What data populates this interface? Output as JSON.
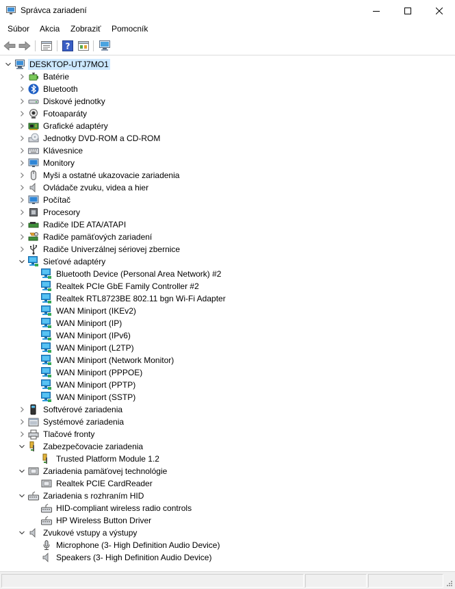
{
  "window": {
    "title": "Správca zariadení"
  },
  "menu": [
    "Súbor",
    "Akcia",
    "Zobraziť",
    "Pomocník"
  ],
  "toolbar": [
    {
      "name": "back-button",
      "icon": "back-arrow-icon"
    },
    {
      "name": "forward-button",
      "icon": "forward-arrow-icon"
    },
    {
      "name": "properties-button",
      "icon": "properties-icon"
    },
    {
      "name": "help-button",
      "icon": "help-icon"
    },
    {
      "name": "view-button",
      "icon": "view-icon"
    },
    {
      "name": "scan-hardware-button",
      "icon": "monitor-scan-icon"
    }
  ],
  "tree": [
    {
      "label": "DESKTOP-UTJ7MO1",
      "level": 0,
      "expander": "open",
      "icon": "computer",
      "selected": true
    },
    {
      "label": "Batérie",
      "level": 1,
      "expander": "closed",
      "icon": "battery"
    },
    {
      "label": "Bluetooth",
      "level": 1,
      "expander": "closed",
      "icon": "bluetooth"
    },
    {
      "label": "Diskové jednotky",
      "level": 1,
      "expander": "closed",
      "icon": "disk"
    },
    {
      "label": "Fotoaparáty",
      "level": 1,
      "expander": "closed",
      "icon": "camera"
    },
    {
      "label": "Grafické adaptéry",
      "level": 1,
      "expander": "closed",
      "icon": "display-adapter"
    },
    {
      "label": "Jednotky DVD-ROM a CD-ROM",
      "level": 1,
      "expander": "closed",
      "icon": "dvd"
    },
    {
      "label": "Klávesnice",
      "level": 1,
      "expander": "closed",
      "icon": "keyboard"
    },
    {
      "label": "Monitory",
      "level": 1,
      "expander": "closed",
      "icon": "monitor"
    },
    {
      "label": "Myši a ostatné ukazovacie zariadenia",
      "level": 1,
      "expander": "closed",
      "icon": "mouse"
    },
    {
      "label": "Ovládače zvuku, videa a hier",
      "level": 1,
      "expander": "closed",
      "icon": "speaker"
    },
    {
      "label": "Počítač",
      "level": 1,
      "expander": "closed",
      "icon": "monitor"
    },
    {
      "label": "Procesory",
      "level": 1,
      "expander": "closed",
      "icon": "processor"
    },
    {
      "label": "Radiče IDE ATA/ATAPI",
      "level": 1,
      "expander": "closed",
      "icon": "ide"
    },
    {
      "label": "Radiče pamäťových zariadení",
      "level": 1,
      "expander": "closed",
      "icon": "storage-controller"
    },
    {
      "label": "Radiče Univerzálnej sériovej zbernice",
      "level": 1,
      "expander": "closed",
      "icon": "usb"
    },
    {
      "label": "Sieťové adaptéry",
      "level": 1,
      "expander": "open",
      "icon": "network"
    },
    {
      "label": "Bluetooth Device (Personal Area Network) #2",
      "level": 2,
      "expander": "none",
      "icon": "network"
    },
    {
      "label": "Realtek PCIe GbE Family Controller #2",
      "level": 2,
      "expander": "none",
      "icon": "network"
    },
    {
      "label": "Realtek RTL8723BE 802.11 bgn Wi-Fi Adapter",
      "level": 2,
      "expander": "none",
      "icon": "network"
    },
    {
      "label": "WAN Miniport (IKEv2)",
      "level": 2,
      "expander": "none",
      "icon": "network"
    },
    {
      "label": "WAN Miniport (IP)",
      "level": 2,
      "expander": "none",
      "icon": "network"
    },
    {
      "label": "WAN Miniport (IPv6)",
      "level": 2,
      "expander": "none",
      "icon": "network"
    },
    {
      "label": "WAN Miniport (L2TP)",
      "level": 2,
      "expander": "none",
      "icon": "network"
    },
    {
      "label": "WAN Miniport (Network Monitor)",
      "level": 2,
      "expander": "none",
      "icon": "network"
    },
    {
      "label": "WAN Miniport (PPPOE)",
      "level": 2,
      "expander": "none",
      "icon": "network"
    },
    {
      "label": "WAN Miniport (PPTP)",
      "level": 2,
      "expander": "none",
      "icon": "network"
    },
    {
      "label": "WAN Miniport (SSTP)",
      "level": 2,
      "expander": "none",
      "icon": "network"
    },
    {
      "label": "Softvérové zariadenia",
      "level": 1,
      "expander": "closed",
      "icon": "software-device"
    },
    {
      "label": "Systémové zariadenia",
      "level": 1,
      "expander": "closed",
      "icon": "system-device"
    },
    {
      "label": "Tlačové fronty",
      "level": 1,
      "expander": "closed",
      "icon": "printer"
    },
    {
      "label": "Zabezpečovacie zariadenia",
      "level": 1,
      "expander": "open",
      "icon": "security"
    },
    {
      "label": "Trusted Platform Module 1.2",
      "level": 2,
      "expander": "none",
      "icon": "security"
    },
    {
      "label": "Zariadenia pamäťovej technológie",
      "level": 1,
      "expander": "open",
      "icon": "memory-tech"
    },
    {
      "label": "Realtek PCIE CardReader",
      "level": 2,
      "expander": "none",
      "icon": "memory-tech"
    },
    {
      "label": "Zariadenia s rozhraním HID",
      "level": 1,
      "expander": "open",
      "icon": "hid"
    },
    {
      "label": "HID-compliant wireless radio controls",
      "level": 2,
      "expander": "none",
      "icon": "hid"
    },
    {
      "label": "HP Wireless Button Driver",
      "level": 2,
      "expander": "none",
      "icon": "hid"
    },
    {
      "label": "Zvukové vstupy a výstupy",
      "level": 1,
      "expander": "open",
      "icon": "speaker"
    },
    {
      "label": "Microphone (3- High Definition Audio Device)",
      "level": 2,
      "expander": "none",
      "icon": "microphone"
    },
    {
      "label": "Speakers (3- High Definition Audio Device)",
      "level": 2,
      "expander": "none",
      "icon": "speaker"
    }
  ]
}
